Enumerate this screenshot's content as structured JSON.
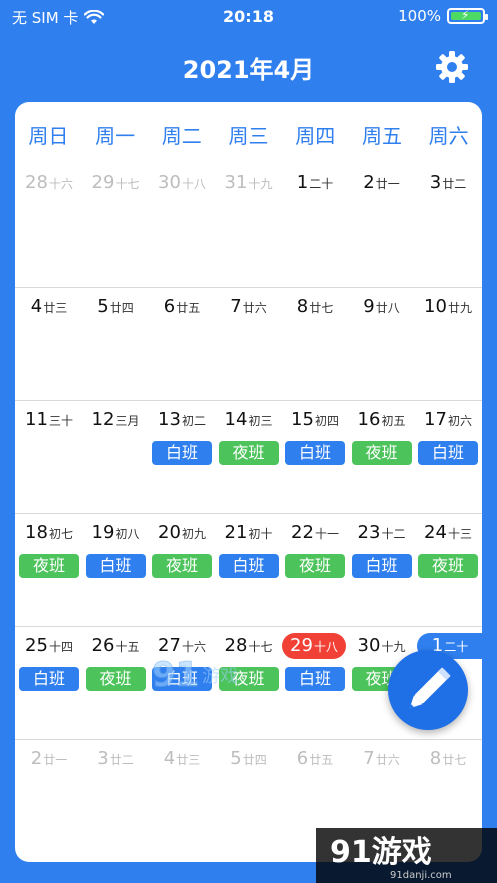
{
  "status_bar": {
    "carrier": "无 SIM 卡",
    "time": "20:18",
    "battery": "100%"
  },
  "header": {
    "title": "2021年4月"
  },
  "weekdays": [
    "周日",
    "周一",
    "周二",
    "周三",
    "周四",
    "周五",
    "周六"
  ],
  "weeks": [
    [
      {
        "d": "28",
        "l": "十六",
        "faded": true
      },
      {
        "d": "29",
        "l": "十七",
        "faded": true
      },
      {
        "d": "30",
        "l": "十八",
        "faded": true
      },
      {
        "d": "31",
        "l": "十九",
        "faded": true
      },
      {
        "d": "1",
        "l": "二十"
      },
      {
        "d": "2",
        "l": "廿一"
      },
      {
        "d": "3",
        "l": "廿二"
      }
    ],
    [
      {
        "d": "4",
        "l": "廿三"
      },
      {
        "d": "5",
        "l": "廿四"
      },
      {
        "d": "6",
        "l": "廿五"
      },
      {
        "d": "7",
        "l": "廿六"
      },
      {
        "d": "8",
        "l": "廿七"
      },
      {
        "d": "9",
        "l": "廿八"
      },
      {
        "d": "10",
        "l": "廿九"
      }
    ],
    [
      {
        "d": "11",
        "l": "三十"
      },
      {
        "d": "12",
        "l": "三月"
      },
      {
        "d": "13",
        "l": "初二",
        "shift": "白班",
        "type": "day"
      },
      {
        "d": "14",
        "l": "初三",
        "shift": "夜班",
        "type": "night"
      },
      {
        "d": "15",
        "l": "初四",
        "shift": "白班",
        "type": "day"
      },
      {
        "d": "16",
        "l": "初五",
        "shift": "夜班",
        "type": "night"
      },
      {
        "d": "17",
        "l": "初六",
        "shift": "白班",
        "type": "day"
      }
    ],
    [
      {
        "d": "18",
        "l": "初七",
        "shift": "夜班",
        "type": "night"
      },
      {
        "d": "19",
        "l": "初八",
        "shift": "白班",
        "type": "day"
      },
      {
        "d": "20",
        "l": "初九",
        "shift": "夜班",
        "type": "night"
      },
      {
        "d": "21",
        "l": "初十",
        "shift": "白班",
        "type": "day"
      },
      {
        "d": "22",
        "l": "十一",
        "shift": "夜班",
        "type": "night"
      },
      {
        "d": "23",
        "l": "十二",
        "shift": "白班",
        "type": "day"
      },
      {
        "d": "24",
        "l": "十三",
        "shift": "夜班",
        "type": "night"
      }
    ],
    [
      {
        "d": "25",
        "l": "十四",
        "shift": "白班",
        "type": "day"
      },
      {
        "d": "26",
        "l": "十五",
        "shift": "夜班",
        "type": "night"
      },
      {
        "d": "27",
        "l": "十六",
        "shift": "白班",
        "type": "day"
      },
      {
        "d": "28",
        "l": "十七",
        "shift": "夜班",
        "type": "night"
      },
      {
        "d": "29",
        "l": "十八",
        "shift": "白班",
        "type": "day",
        "today": true
      },
      {
        "d": "30",
        "l": "十九",
        "shift": "夜班",
        "type": "night"
      },
      {
        "d": "1",
        "l": "二十",
        "next": true
      }
    ],
    [
      {
        "d": "2",
        "l": "廿一",
        "faded": true
      },
      {
        "d": "3",
        "l": "廿二",
        "faded": true
      },
      {
        "d": "4",
        "l": "廿三",
        "faded": true
      },
      {
        "d": "5",
        "l": "廿四",
        "faded": true
      },
      {
        "d": "6",
        "l": "廿五",
        "faded": true
      },
      {
        "d": "7",
        "l": "廿六",
        "faded": true
      },
      {
        "d": "8",
        "l": "廿七",
        "faded": true
      }
    ]
  ],
  "watermark": {
    "text_center": "游戏",
    "brand": "91游戏",
    "brand_url": "91danji.com"
  },
  "colors": {
    "primary": "#2f7fee",
    "night_shift": "#4cc35b",
    "today": "#f14136"
  }
}
